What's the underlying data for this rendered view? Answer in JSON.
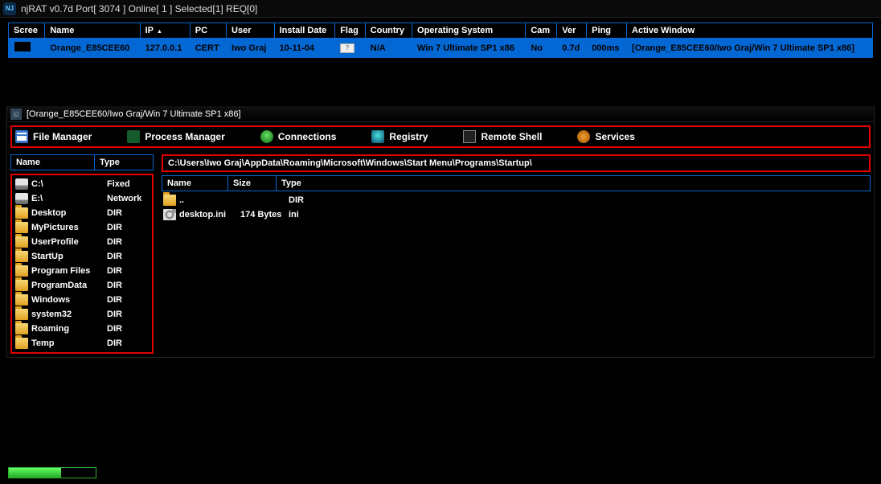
{
  "app": {
    "title": "njRAT v0.7d    Port[ 3074 ]    Online[ 1 ]    Selected[1] REQ[0]"
  },
  "conn_table": {
    "headers": {
      "screen": "Scree",
      "name": "Name",
      "ip": "IP",
      "pc": "PC",
      "user": "User",
      "install_date": "Install Date",
      "flag": "Flag",
      "country": "Country",
      "os": "Operating System",
      "cam": "Cam",
      "ver": "Ver",
      "ping": "Ping",
      "active_window": "Active Window"
    },
    "row": {
      "name": "Orange_E85CEE60",
      "ip": "127.0.0.1",
      "pc": "CERT",
      "user": "Iwo Graj",
      "install_date": "10-11-04",
      "flag": "?",
      "country": "N/A",
      "os": "Win 7 Ultimate SP1 x86",
      "cam": "No",
      "ver": "0.7d",
      "ping": "000ms",
      "active_window": "[Orange_E85CEE60/Iwo Graj/Win 7 Ultimate SP1 x86]"
    }
  },
  "child": {
    "title": "[Orange_E85CEE60/Iwo Graj/Win 7 Ultimate SP1 x86]"
  },
  "toolbar": {
    "file_manager": "File Manager",
    "process_manager": "Process Manager",
    "connections": "Connections",
    "registry": "Registry",
    "remote_shell": "Remote Shell",
    "services": "Services"
  },
  "fm": {
    "left_headers": {
      "name": "Name",
      "type": "Type"
    },
    "left_items": [
      {
        "icon": "drive",
        "name": "C:\\",
        "type": "Fixed"
      },
      {
        "icon": "drive",
        "name": "E:\\",
        "type": "Network"
      },
      {
        "icon": "folder",
        "name": "Desktop",
        "type": "DIR"
      },
      {
        "icon": "folder",
        "name": "MyPictures",
        "type": "DIR"
      },
      {
        "icon": "folder",
        "name": "UserProfile",
        "type": "DIR"
      },
      {
        "icon": "folder",
        "name": "StartUp",
        "type": "DIR"
      },
      {
        "icon": "folder",
        "name": "Program Files",
        "type": "DIR"
      },
      {
        "icon": "folder",
        "name": "ProgramData",
        "type": "DIR"
      },
      {
        "icon": "folder",
        "name": "Windows",
        "type": "DIR"
      },
      {
        "icon": "folder",
        "name": "system32",
        "type": "DIR"
      },
      {
        "icon": "folder",
        "name": "Roaming",
        "type": "DIR"
      },
      {
        "icon": "folder",
        "name": "Temp",
        "type": "DIR"
      }
    ],
    "path": "C:\\Users\\Iwo Graj\\AppData\\Roaming\\Microsoft\\Windows\\Start Menu\\Programs\\Startup\\",
    "right_headers": {
      "name": "Name",
      "size": "Size",
      "type": "Type"
    },
    "right_items": [
      {
        "icon": "folder",
        "name": "..",
        "size": "",
        "type": "DIR"
      },
      {
        "icon": "file gear",
        "name": "desktop.ini",
        "size": "174 Bytes",
        "type": "ini"
      }
    ]
  }
}
